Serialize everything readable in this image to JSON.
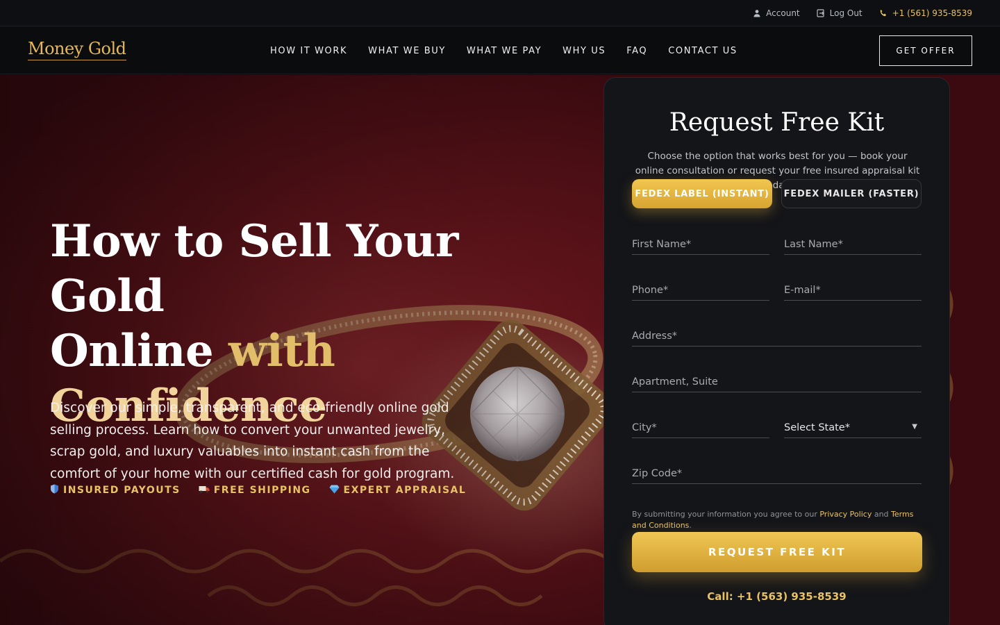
{
  "topbar": {
    "account": "Account",
    "logout": "Log Out",
    "phone": "+1 (561) 935-8539"
  },
  "brand": {
    "logo": "Money Gold"
  },
  "nav": {
    "items": [
      "HOW IT WORK",
      "WHAT WE BUY",
      "WHAT WE PAY",
      "WHY US",
      "FAQ",
      "CONTACT US"
    ],
    "cta": "GET OFFER"
  },
  "hero": {
    "headline_line1": "How to Sell Your Gold",
    "headline_line2a": "Online ",
    "headline_line2b": "with",
    "headline_line3": "Confidence",
    "lede": "Discover our simple, transparent, and eco-friendly online gold selling process. Learn how to convert your unwanted jewelry, scrap gold, and luxury valuables into instant cash from the comfort of your home with our certified cash for gold program.",
    "features": [
      {
        "icon": "shield-icon",
        "label": "INSURED PAYOUTS"
      },
      {
        "icon": "truck-icon",
        "label": "FREE SHIPPING"
      },
      {
        "icon": "diamond-icon",
        "label": "EXPERT APPRAISAL"
      }
    ]
  },
  "form": {
    "title": "Request Free Kit",
    "subtitle": "Choose the option that works best for you — book your online consultation or request your free insured appraisal kit today.",
    "tabs": [
      "FEDEX LABEL (INSTANT)",
      "FEDEX MAILER (FASTER)"
    ],
    "active_tab": "FEDEX LABEL (INSTANT)",
    "placeholders": {
      "first_name": "First Name*",
      "last_name": "Last Name*",
      "phone": "Phone*",
      "email": "E-mail*",
      "address": "Address*",
      "apartment": "Apartment, Suite",
      "city": "City*",
      "state": "Select State*",
      "zip": "Zip Code*"
    },
    "legal_prefix": "By submitting your information you agree to our ",
    "privacy": "Privacy Policy",
    "legal_and": " and ",
    "terms": "Terms and Conditions",
    "legal_suffix": ".",
    "submit": "REQUEST FREE KIT",
    "call": "Call: +1 (563) 935-8539"
  },
  "colors": {
    "gold": "#e8c264",
    "button_gold": "#e0b03e",
    "hero_red": "#7a1c22",
    "panel_bg": "#141519"
  }
}
